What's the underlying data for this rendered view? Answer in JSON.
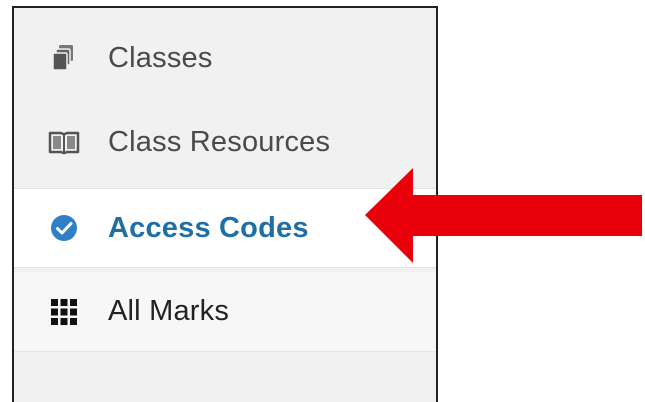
{
  "nav": {
    "items": [
      {
        "label": "Classes",
        "icon": "classes-stack-icon",
        "active": false
      },
      {
        "label": "Class Resources",
        "icon": "open-book-icon",
        "active": false
      },
      {
        "label": "Access Codes",
        "icon": "check-circle-icon",
        "active": true
      },
      {
        "label": "All Marks",
        "icon": "grid-icon",
        "active": false
      }
    ]
  },
  "colors": {
    "active_text": "#1f6fa6",
    "active_icon": "#2f7fc8",
    "inactive_text": "#4a4a4a",
    "inactive_icon": "#555555",
    "arrow": "#e8000b",
    "panel_bg": "#f1f1f1"
  }
}
